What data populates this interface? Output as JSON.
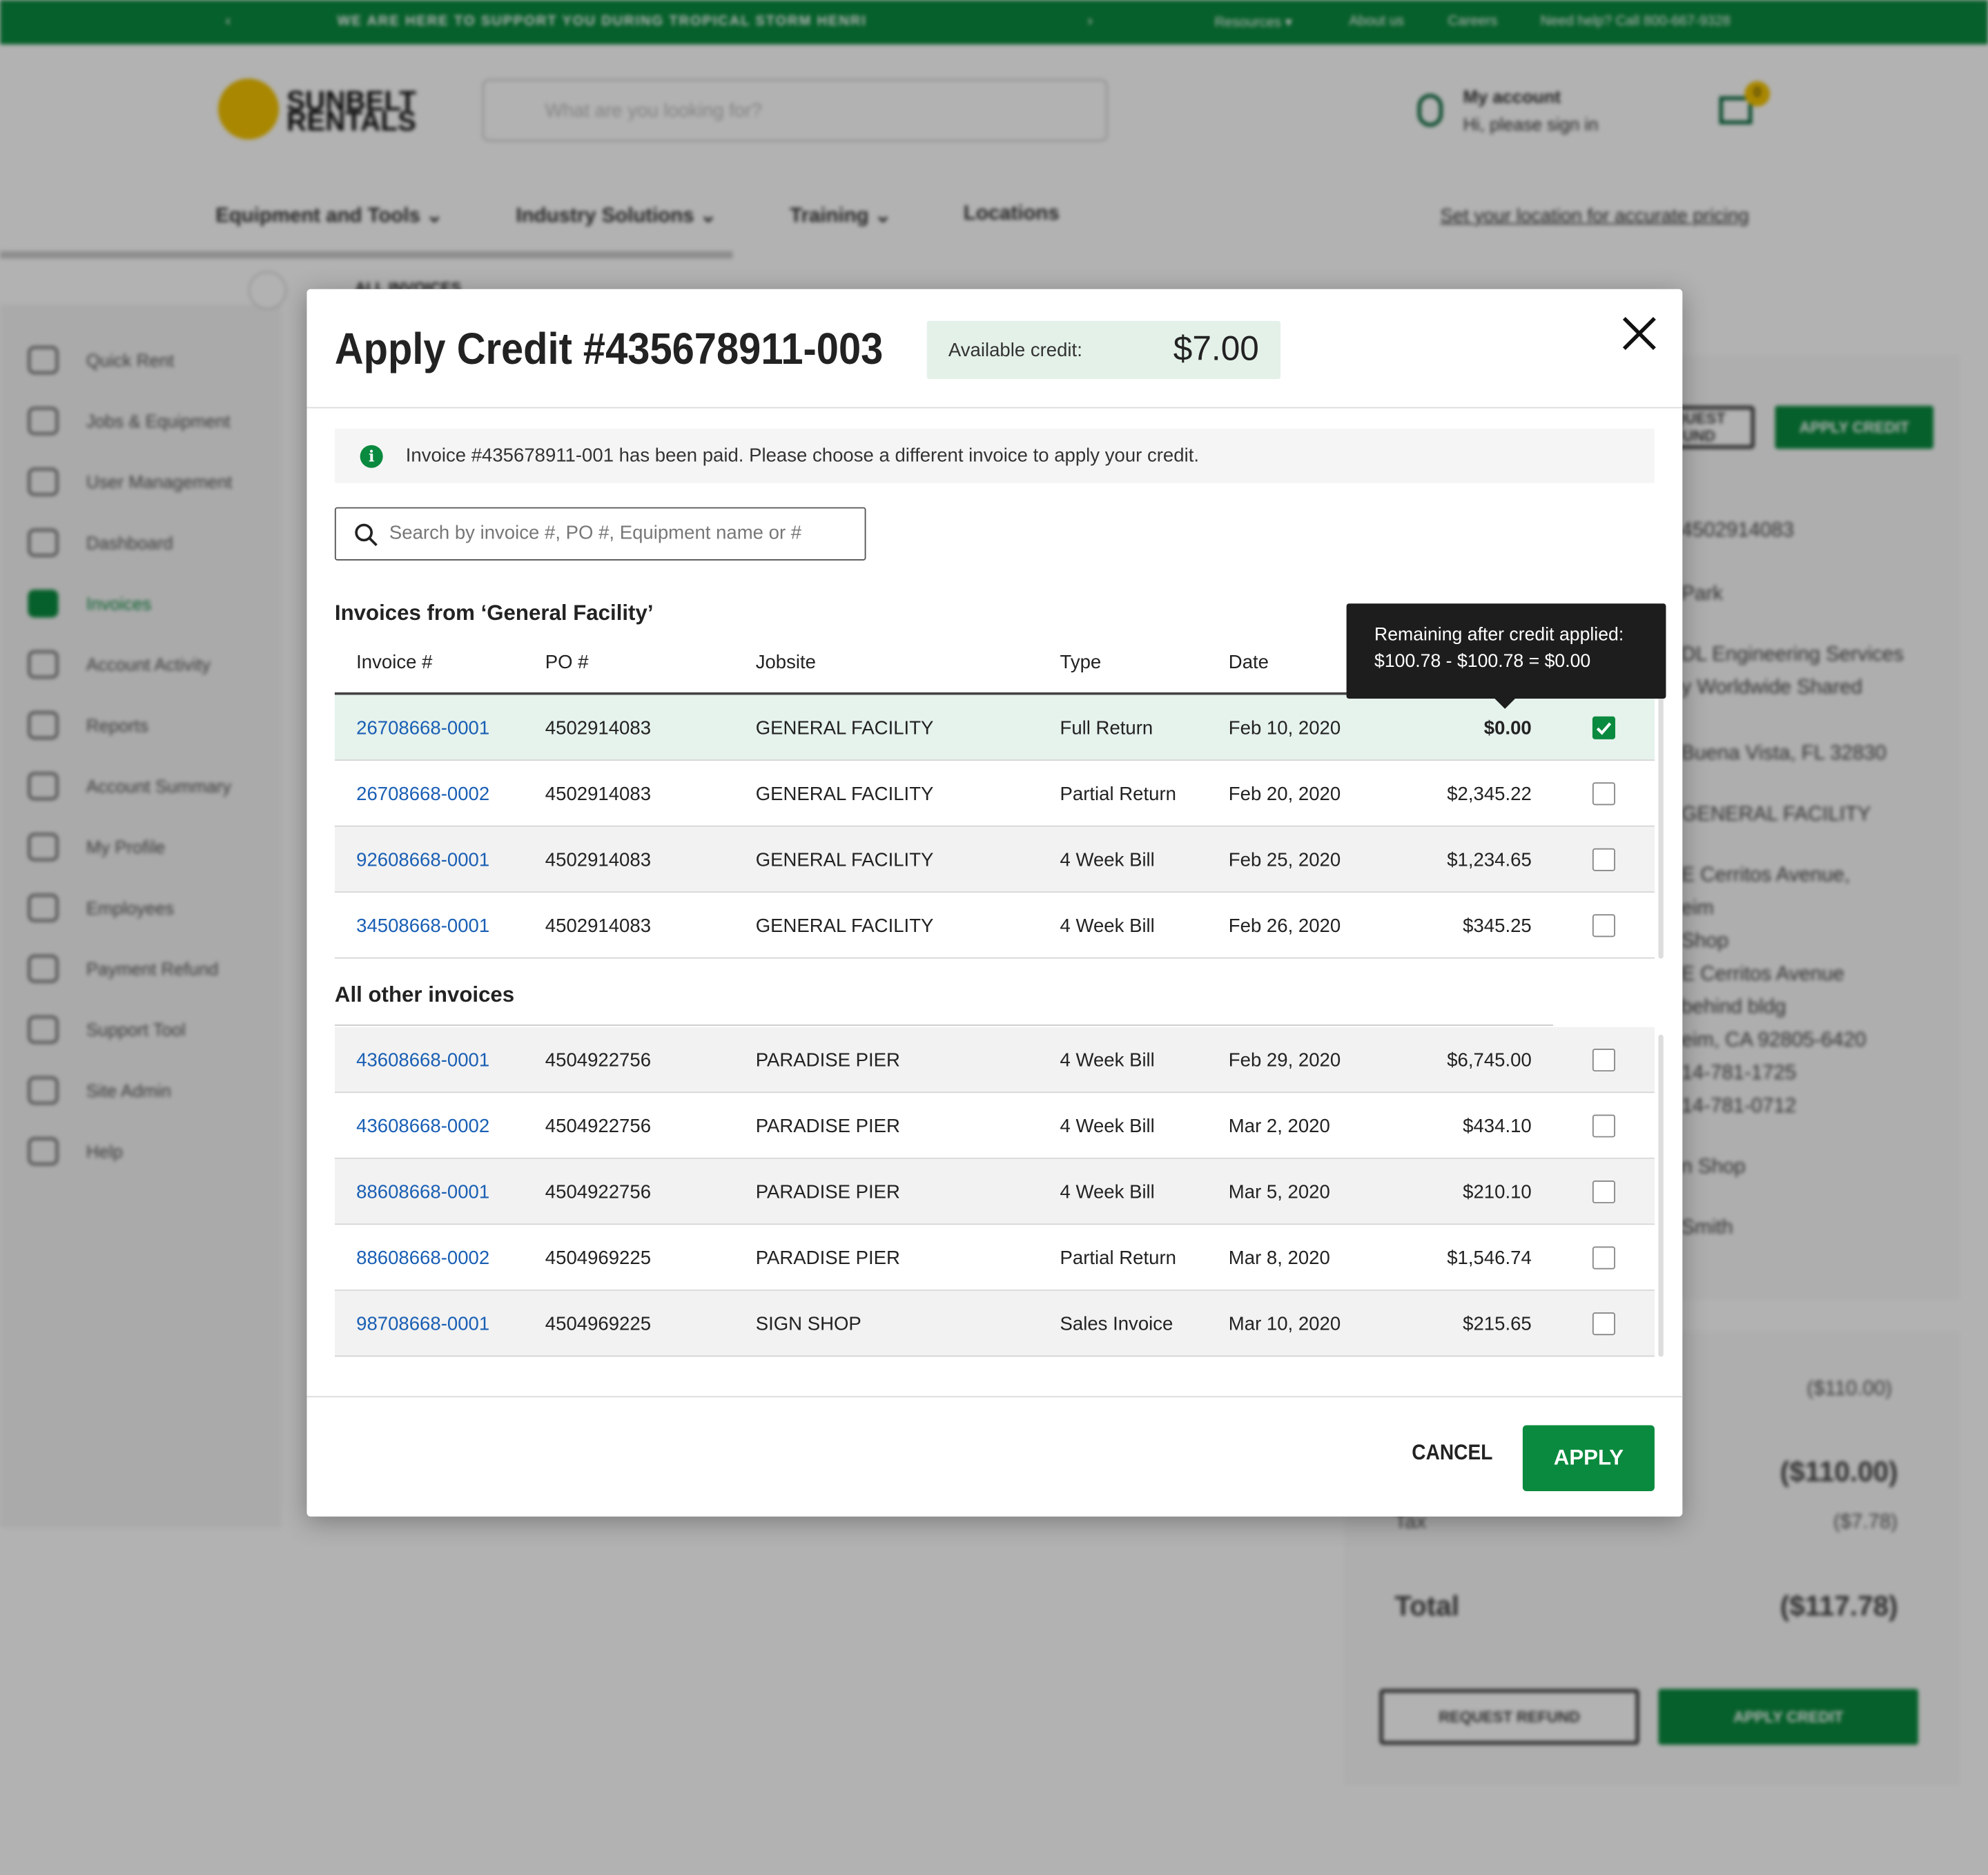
{
  "background": {
    "banner": {
      "message": "WE ARE HERE TO SUPPORT YOU DURING TROPICAL STORM HENRI",
      "links": [
        "Resources ▾",
        "About us",
        "Careers",
        "Need help? Call 800-667-9328"
      ]
    },
    "logo": "SUNBELT RENTALS",
    "search_placeholder": "What are you looking for?",
    "account": {
      "title": "My account",
      "subtitle": "Hi, please sign in"
    },
    "cart_count": "0",
    "nav": [
      "Equipment and Tools ⌄",
      "Industry Solutions ⌄",
      "Training ⌄",
      "Locations"
    ],
    "location_link": "Set your location for accurate pricing",
    "breadcrumb": "ALL INVOICES",
    "sidebar": [
      {
        "label": "Quick Rent"
      },
      {
        "label": "Jobs & Equipment"
      },
      {
        "label": "User Management"
      },
      {
        "label": "Dashboard"
      },
      {
        "label": "Invoices",
        "active": true
      },
      {
        "label": "Account Activity"
      },
      {
        "label": "Reports"
      },
      {
        "label": "Account Summary"
      },
      {
        "label": "My Profile"
      },
      {
        "label": "Employees"
      },
      {
        "label": "Payment Refund"
      },
      {
        "label": "Support Tool"
      },
      {
        "label": "Site Admin"
      },
      {
        "label": "Help"
      }
    ],
    "right_panel": {
      "refund_label": "REQUEST REFUND",
      "apply_credit_label": "APPLY CREDIT",
      "details": [
        "4502914083",
        "Park",
        "DL Engineering Services",
        "y Worldwide Shared",
        "Buena Vista, FL 32830",
        "GENERAL FACILITY",
        "E Cerritos Avenue,",
        "eim",
        "Shop",
        "E Cerritos Avenue",
        "behind bldg",
        "eim, CA 92805-6420",
        "14-781-1725",
        "14-781-0712",
        "n Shop",
        "Smith"
      ],
      "subtotal1": "($110.00)",
      "subtotal2": "($110.00)",
      "tax_label": "Tax",
      "tax": "($7.78)",
      "total_label": "Total",
      "total": "($117.78)"
    }
  },
  "modal": {
    "title": "Apply Credit #435678911-003",
    "available_credit_label": "Available credit:",
    "available_credit": "$7.00",
    "info_message": "Invoice #435678911-001 has been paid. Please choose a different invoice to apply your credit.",
    "search_placeholder": "Search by invoice #, PO #, Equipment name or #",
    "section1_title": "Invoices from ‘General Facility’",
    "section2_title": "All other invoices",
    "columns": [
      "Invoice #",
      "PO #",
      "Jobsite",
      "Type",
      "Date"
    ],
    "tooltip": {
      "line1": "Remaining after credit applied:",
      "line2": "$100.78 - $100.78 = $0.00"
    },
    "group1": [
      {
        "invoice": "26708668-0001",
        "po": "4502914083",
        "jobsite": "GENERAL FACILITY",
        "type": "Full Return",
        "date": "Feb 10, 2020",
        "amount": "$0.00",
        "checked": true
      },
      {
        "invoice": "26708668-0002",
        "po": "4502914083",
        "jobsite": "GENERAL FACILITY",
        "type": "Partial Return",
        "date": "Feb 20, 2020",
        "amount": "$2,345.22",
        "checked": false
      },
      {
        "invoice": "92608668-0001",
        "po": "4502914083",
        "jobsite": "GENERAL FACILITY",
        "type": "4 Week Bill",
        "date": "Feb 25, 2020",
        "amount": "$1,234.65",
        "checked": false
      },
      {
        "invoice": "34508668-0001",
        "po": "4502914083",
        "jobsite": "GENERAL FACILITY",
        "type": "4 Week Bill",
        "date": "Feb 26, 2020",
        "amount": "$345.25",
        "checked": false
      }
    ],
    "group2": [
      {
        "invoice": "43608668-0001",
        "po": "4504922756",
        "jobsite": "PARADISE PIER",
        "type": "4 Week Bill",
        "date": "Feb 29, 2020",
        "amount": "$6,745.00",
        "checked": false
      },
      {
        "invoice": "43608668-0002",
        "po": "4504922756",
        "jobsite": "PARADISE PIER",
        "type": "4 Week Bill",
        "date": "Mar 2, 2020",
        "amount": "$434.10",
        "checked": false
      },
      {
        "invoice": "88608668-0001",
        "po": "4504922756",
        "jobsite": "PARADISE PIER",
        "type": "4 Week Bill",
        "date": "Mar 5, 2020",
        "amount": "$210.10",
        "checked": false
      },
      {
        "invoice": "88608668-0002",
        "po": "4504969225",
        "jobsite": "PARADISE PIER",
        "type": "Partial Return",
        "date": "Mar 8, 2020",
        "amount": "$1,546.74",
        "checked": false
      },
      {
        "invoice": "98708668-0001",
        "po": "4504969225",
        "jobsite": "SIGN SHOP",
        "type": "Sales Invoice",
        "date": "Mar 10, 2020",
        "amount": "$215.65",
        "checked": false
      }
    ],
    "cancel_label": "CANCEL",
    "apply_label": "APPLY"
  },
  "colors": {
    "brand_green": "#0a8a3e",
    "link_blue": "#1a5fb4",
    "selected_row": "#e6f2ec",
    "tooltip_bg": "#1d1d1d"
  }
}
